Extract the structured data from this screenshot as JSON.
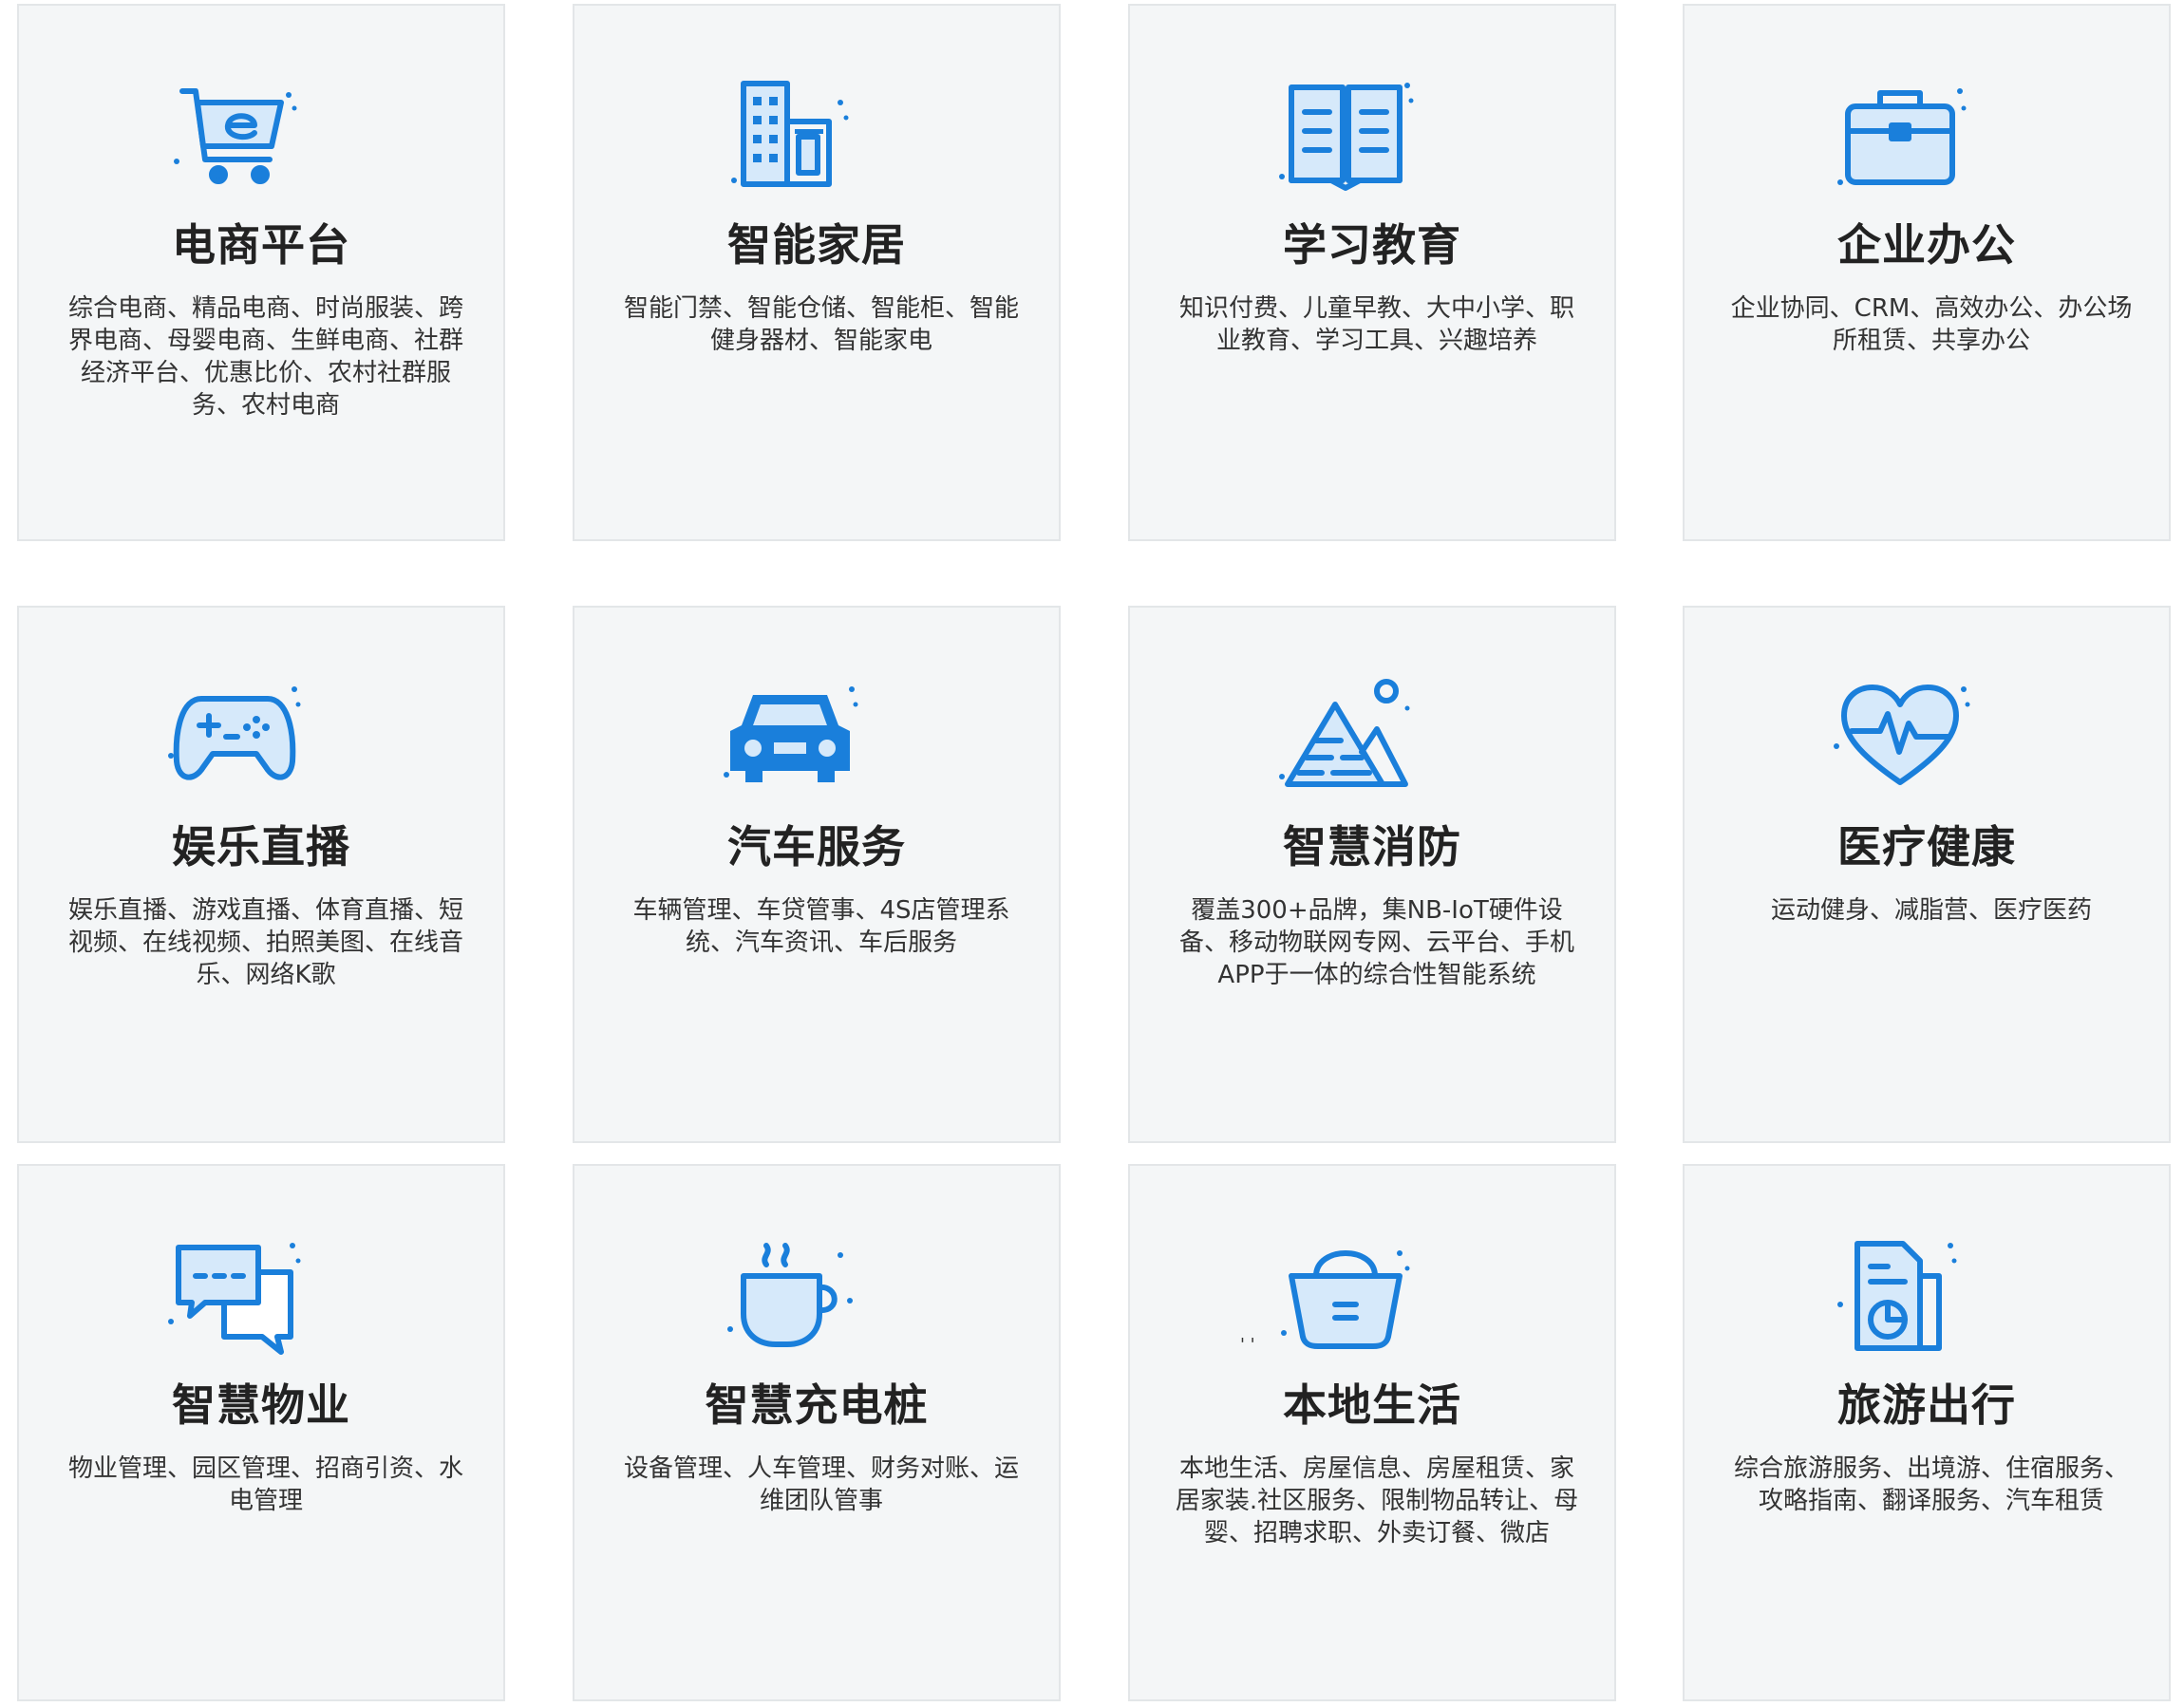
{
  "colors": {
    "card_bg": "#f4f6f7",
    "card_border": "#e3e6e8",
    "icon_stroke": "#1a7fdb",
    "icon_fill": "#d6e9fa",
    "title": "#222222",
    "text": "#333333"
  },
  "cards": [
    {
      "title": "电商平台",
      "desc": "综合电商、精品电商、时尚服装、跨界电商、母婴电商、生鲜电商、社群经济平台、优惠比价、农村社群服务、农村电商",
      "icon": "shopping-cart-icon"
    },
    {
      "title": "智能家居",
      "desc": "智能门禁、智能仓储、智能柜、智能健身器材、智能家电",
      "icon": "building-icon"
    },
    {
      "title": "学习教育",
      "desc": "知识付费、儿童早教、大中小学、职业教育、学习工具、兴趣培养",
      "icon": "open-book-icon"
    },
    {
      "title": "企业办公",
      "desc": "企业协同、CRM、高效办公、办公场所租赁、共享办公",
      "icon": "briefcase-icon"
    },
    {
      "title": "娱乐直播",
      "desc": "娱乐直播、游戏直播、体育直播、短视频、在线视频、拍照美图、在线音乐、网络K歌",
      "icon": "gamepad-icon"
    },
    {
      "title": "汽车服务",
      "desc": "车辆管理、车贷管事、4S店管理系统、汽车资讯、车后服务",
      "icon": "car-icon"
    },
    {
      "title": "智慧消防",
      "desc": "覆盖300+品牌，集NB-IoT硬件设备、移动物联网专网、云平台、手机APP于一体的综合性智能系统",
      "icon": "pyramid-icon"
    },
    {
      "title": "医疗健康",
      "desc": "运动健身、减脂营、医疗医药",
      "icon": "heart-pulse-icon"
    },
    {
      "title": "智慧物业",
      "desc": "物业管理、园区管理、招商引资、水电管理",
      "icon": "chat-bubbles-icon"
    },
    {
      "title": "智慧充电桩",
      "desc": "设备管理、人车管理、财务对账、运维团队管事",
      "icon": "coffee-cup-icon"
    },
    {
      "title": "本地生活",
      "desc": "本地生活、房屋信息、房屋租赁、家居家装.社区服务、限制物品转让、母婴、招聘求职、外卖订餐、微店",
      "icon": "basket-icon"
    },
    {
      "title": "旅游出行",
      "desc": "综合旅游服务、出境游、住宿服务、攻略指南、翻译服务、汽车租赁",
      "icon": "document-chart-icon"
    }
  ],
  "stray_mark": "' '"
}
